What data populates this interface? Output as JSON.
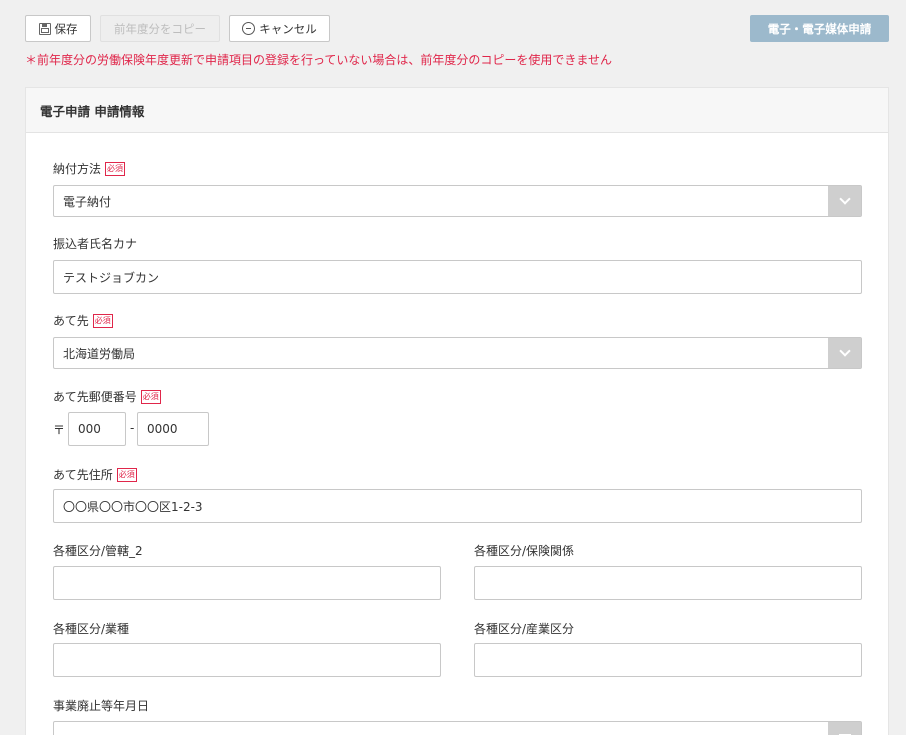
{
  "toolbar": {
    "save_label": "保存",
    "copy_label": "前年度分をコピー",
    "cancel_label": "キャンセル",
    "electronic_label": "電子・電子媒体申請"
  },
  "warning": "＊前年度分の労働保険年度更新で申請項目の登録を行っていない場合は、前年度分のコピーを使用できません",
  "panel": {
    "title": "電子申請 申請情報"
  },
  "required_badge": "必須",
  "fields": {
    "payment_method": {
      "label": "納付方法",
      "value": "電子納付"
    },
    "transfer_name_kana": {
      "label": "振込者氏名カナ",
      "value": "テストジョブカン"
    },
    "destination": {
      "label": "あて先",
      "value": "北海道労働局"
    },
    "destination_zip": {
      "label": "あて先郵便番号",
      "zip_mark": "〒",
      "zip1": "000",
      "separator": "-",
      "zip2": "0000"
    },
    "destination_address": {
      "label": "あて先住所",
      "value": "〇〇県〇〇市〇〇区1-2-3"
    },
    "category_jurisdiction": {
      "label": "各種区分/管轄_2",
      "value": ""
    },
    "category_insurance": {
      "label": "各種区分/保険関係",
      "value": ""
    },
    "category_business_type": {
      "label": "各種区分/業種",
      "value": ""
    },
    "category_industry": {
      "label": "各種区分/産業区分",
      "value": ""
    },
    "business_closure_date": {
      "label": "事業廃止等年月日",
      "value": ""
    }
  },
  "colors": {
    "warning": "#e0264a",
    "electronic_button": "#9cb9cc",
    "select_arrow_bg": "#cfcfcf"
  }
}
